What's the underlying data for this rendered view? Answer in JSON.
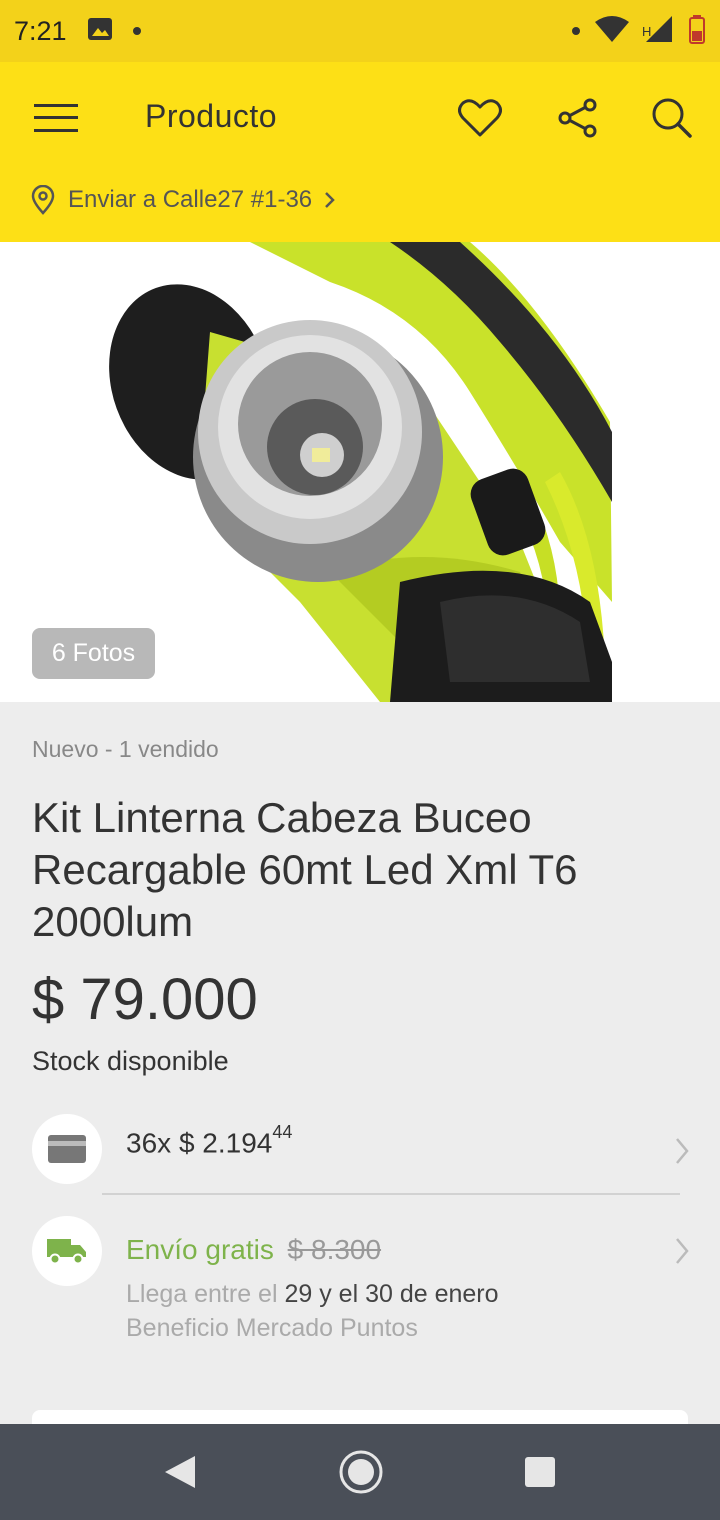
{
  "status_bar": {
    "time": "7:21",
    "network_label": "H"
  },
  "header": {
    "title": "Producto",
    "shipping_prefix": "Enviar a",
    "shipping_address": "Calle27 #1-36"
  },
  "gallery": {
    "photo_count_label": "6 Fotos"
  },
  "product": {
    "condition": "Nuevo - 1 vendido",
    "title": "Kit Linterna Cabeza Buceo Recargable 60mt Led Xml T6 2000lum",
    "price": "$ 79.000",
    "stock": "Stock disponible"
  },
  "installments": {
    "count": "36x",
    "amount": "$ 2.194",
    "cents": "44"
  },
  "shipping": {
    "free_label": "Envío gratis",
    "old_price": "$ 8.300",
    "arrive_prefix": "Llega entre el",
    "arrive_dates": "29 y el 30 de enero",
    "benefit": "Beneficio Mercado Puntos"
  },
  "colors": {
    "accent": "#fde016",
    "status_bar": "#f3d21a",
    "free_shipping": "#7eb34b",
    "nav_bar": "#4a4f58"
  }
}
